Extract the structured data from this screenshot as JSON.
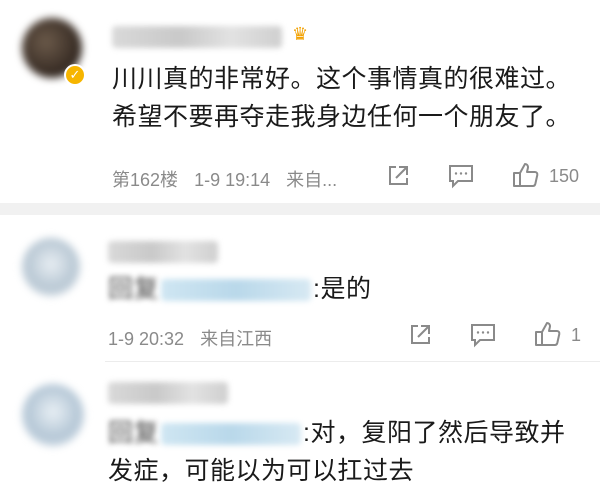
{
  "comments": [
    {
      "text": "川川真的非常好。这个事情真的很难过。希望不要再夺走我身边任何一个朋友了。",
      "floor": "第162楼",
      "time": "1-9 19:14",
      "source": "来自...",
      "like_count": "150",
      "crown_icon": "crown-icon",
      "verified_icon": "verified-badge-icon"
    },
    {
      "text_prefix": "回复",
      "text_suffix": ":是的",
      "time": "1-9 20:32",
      "source": "来自江西",
      "like_count": "1"
    },
    {
      "text_prefix": "回复",
      "text_suffix": ":对，复阳了然后导致并发症，可能以为可以扛过去"
    }
  ],
  "icons": {
    "share": "share-icon",
    "comment": "comment-icon",
    "like": "thumbs-up-icon"
  },
  "colors": {
    "meta_text": "#8a8a8a",
    "body_text": "#1a1a1a",
    "divider": "#f1f1f1",
    "vip_gold": "#f6b500"
  }
}
